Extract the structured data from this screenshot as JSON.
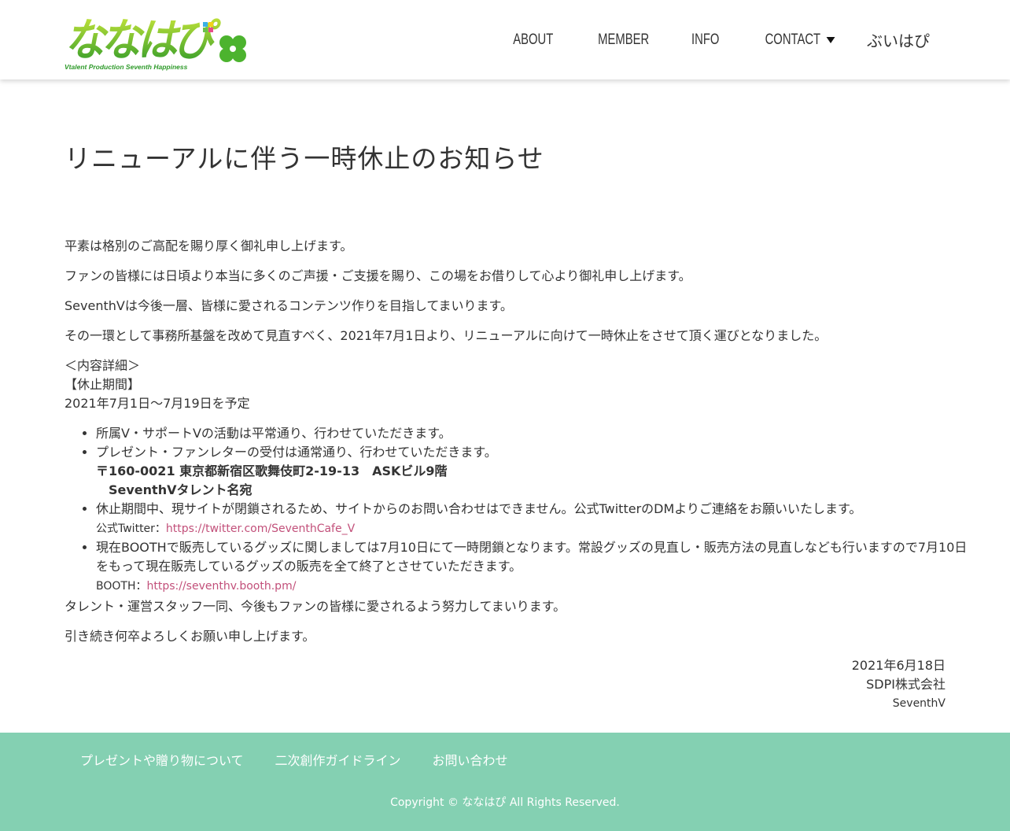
{
  "header": {
    "logo_text": "ななはぴ",
    "logo_tagline": "Vtalent Production Seventh Happiness",
    "nav": {
      "about": "ABOUT",
      "member": "MEMBER",
      "info": "INFO",
      "contact": "CONTACT",
      "brand": "ぶいはぴ"
    }
  },
  "article": {
    "title": "リニューアルに伴う一時休止のお知らせ",
    "p1": "平素は格別のご高配を賜り厚く御礼申し上げます。",
    "p2": "ファンの皆様には日頃より本当に多くのご声援・ご支援を賜り、この場をお借りして心より御礼申し上げます。",
    "p3": "SeventhVは今後一層、皆様に愛されるコンテンツ作りを目指してまいります。",
    "p4": "その一環として事務所基盤を改めて見直すべく、2021年7月1日より、リニューアルに向けて一時休止をさせて頂く運びとなりました。",
    "detail_heading": "＜内容詳細＞",
    "period_label": "【休止期間】",
    "period_value": "2021年7月1日～7月19日を予定",
    "li1": "所属V・サポートVの活動は平常通り、行わせていただきます。",
    "li2": "プレゼント・ファンレターの受付は通常通り、行わせていただきます。",
    "li2_address": "〒160-0021 東京都新宿区歌舞伎町2-19-13　ASKビル9階",
    "li2_recipient": "SeventhVタレント名宛",
    "li3": "休止期間中、現サイトが閉鎖されるため、サイトからのお問い合わせはできません。公式TwitterのDMよりご連絡をお願いいたします。",
    "li3_label": "公式Twitter：",
    "li3_link": "https://twitter.com/SeventhCafe_V",
    "li4_line1": "現在BOOTHで販売しているグッズに関しましては7月10日にて一時閉鎖となります。常設グッズの見直し・販売方法の見直しなども行いますので7月10日",
    "li4_line2": "をもって現在販売しているグッズの販売を全て終了とさせていただきます。",
    "li4_label": "BOOTH：",
    "li4_link": "https://seventhv.booth.pm/",
    "p5": "タレント・運営スタッフ一同、今後もファンの皆様に愛されるよう努力してまいります。",
    "p6": "引き続き何卒よろしくお願い申し上げます。",
    "date": "2021年6月18日",
    "company": "SDPI株式会社",
    "brand": "SeventhV"
  },
  "footer": {
    "link1": "プレゼントや贈り物について",
    "link2": "二次創作ガイドライン",
    "link3": "お問い合わせ",
    "copyright": "Copyright © ななはぴ All Rights Reserved."
  },
  "colors": {
    "logo_green": "#5fb82e",
    "footer_bg": "#84d0b2",
    "link": "#c2507a"
  }
}
